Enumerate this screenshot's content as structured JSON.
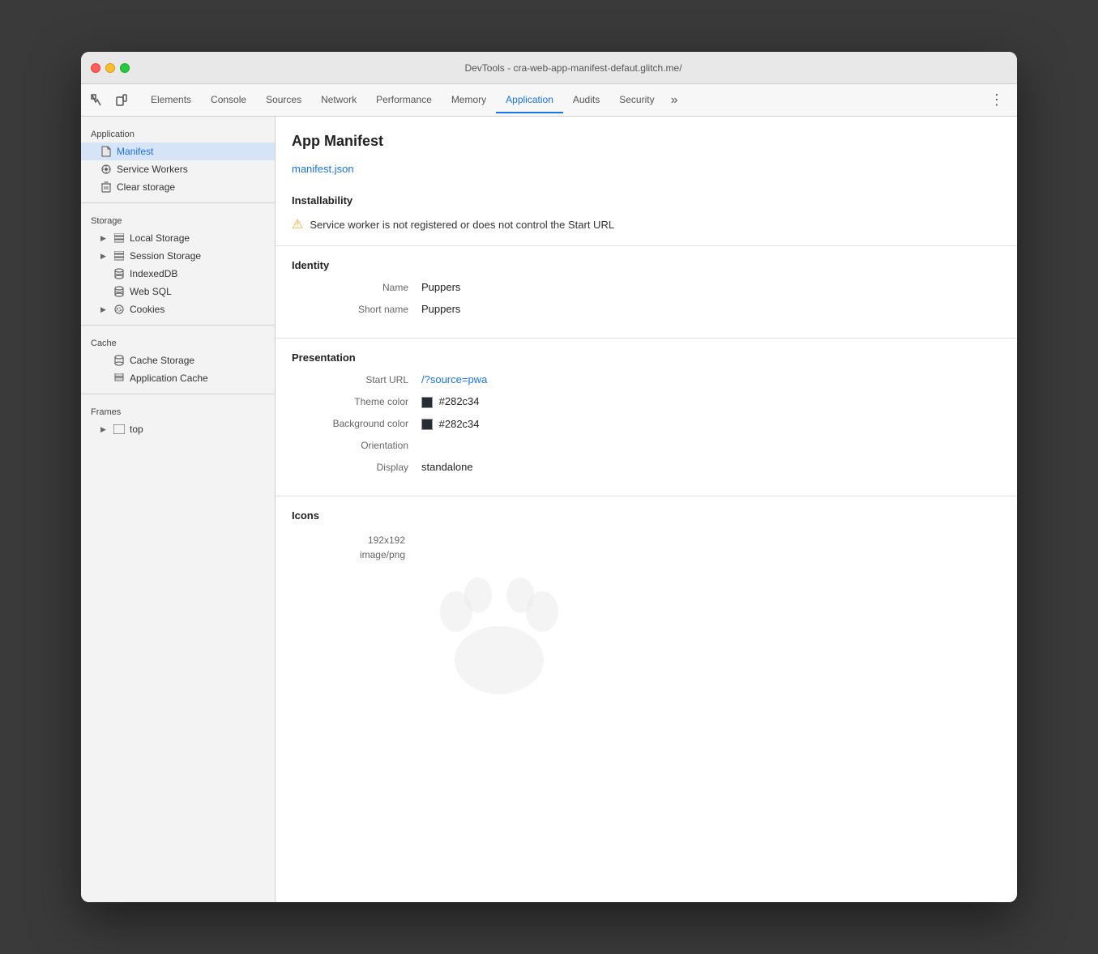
{
  "window": {
    "title": "DevTools - cra-web-app-manifest-defaut.glitch.me/"
  },
  "toolbar": {
    "tabs": [
      {
        "id": "elements",
        "label": "Elements",
        "active": false
      },
      {
        "id": "console",
        "label": "Console",
        "active": false
      },
      {
        "id": "sources",
        "label": "Sources",
        "active": false
      },
      {
        "id": "network",
        "label": "Network",
        "active": false
      },
      {
        "id": "performance",
        "label": "Performance",
        "active": false
      },
      {
        "id": "memory",
        "label": "Memory",
        "active": false
      },
      {
        "id": "application",
        "label": "Application",
        "active": true
      },
      {
        "id": "audits",
        "label": "Audits",
        "active": false
      },
      {
        "id": "security",
        "label": "Security",
        "active": false
      }
    ],
    "more_label": "»",
    "menu_label": "⋮"
  },
  "sidebar": {
    "sections": [
      {
        "title": "Application",
        "items": [
          {
            "id": "manifest",
            "label": "Manifest",
            "icon": "📄",
            "active": true,
            "indent": false
          },
          {
            "id": "service-workers",
            "label": "Service Workers",
            "icon": "⚙",
            "active": false,
            "indent": false
          },
          {
            "id": "clear-storage",
            "label": "Clear storage",
            "icon": "🗑",
            "active": false,
            "indent": false
          }
        ]
      },
      {
        "title": "Storage",
        "items": [
          {
            "id": "local-storage",
            "label": "Local Storage",
            "icon": "▸",
            "active": false,
            "indent": false,
            "has_arrow": true
          },
          {
            "id": "session-storage",
            "label": "Session Storage",
            "icon": "▸",
            "active": false,
            "indent": false,
            "has_arrow": true
          },
          {
            "id": "indexeddb",
            "label": "IndexedDB",
            "icon": "",
            "active": false,
            "indent": false
          },
          {
            "id": "web-sql",
            "label": "Web SQL",
            "icon": "",
            "active": false,
            "indent": false
          },
          {
            "id": "cookies",
            "label": "Cookies",
            "icon": "▸",
            "active": false,
            "indent": false,
            "has_arrow": true
          }
        ]
      },
      {
        "title": "Cache",
        "items": [
          {
            "id": "cache-storage",
            "label": "Cache Storage",
            "icon": "",
            "active": false,
            "indent": false
          },
          {
            "id": "application-cache",
            "label": "Application Cache",
            "icon": "",
            "active": false,
            "indent": false
          }
        ]
      },
      {
        "title": "Frames",
        "items": [
          {
            "id": "top",
            "label": "top",
            "icon": "▸",
            "active": false,
            "indent": false,
            "has_arrow": true
          }
        ]
      }
    ]
  },
  "main": {
    "page_title": "App Manifest",
    "manifest_link": "manifest.json",
    "installability": {
      "section_title": "Installability",
      "warning_text": "Service worker is not registered or does not control the Start URL"
    },
    "identity": {
      "section_title": "Identity",
      "fields": [
        {
          "label": "Name",
          "value": "Puppers",
          "type": "text"
        },
        {
          "label": "Short name",
          "value": "Puppers",
          "type": "text"
        }
      ]
    },
    "presentation": {
      "section_title": "Presentation",
      "fields": [
        {
          "label": "Start URL",
          "value": "/?source=pwa",
          "type": "link"
        },
        {
          "label": "Theme color",
          "value": "#282c34",
          "type": "color"
        },
        {
          "label": "Background color",
          "value": "#282c34",
          "type": "color"
        },
        {
          "label": "Orientation",
          "value": "",
          "type": "text"
        },
        {
          "label": "Display",
          "value": "standalone",
          "type": "text"
        }
      ]
    },
    "icons": {
      "section_title": "Icons",
      "items": [
        {
          "size": "192x192",
          "type": "image/png"
        }
      ]
    }
  }
}
